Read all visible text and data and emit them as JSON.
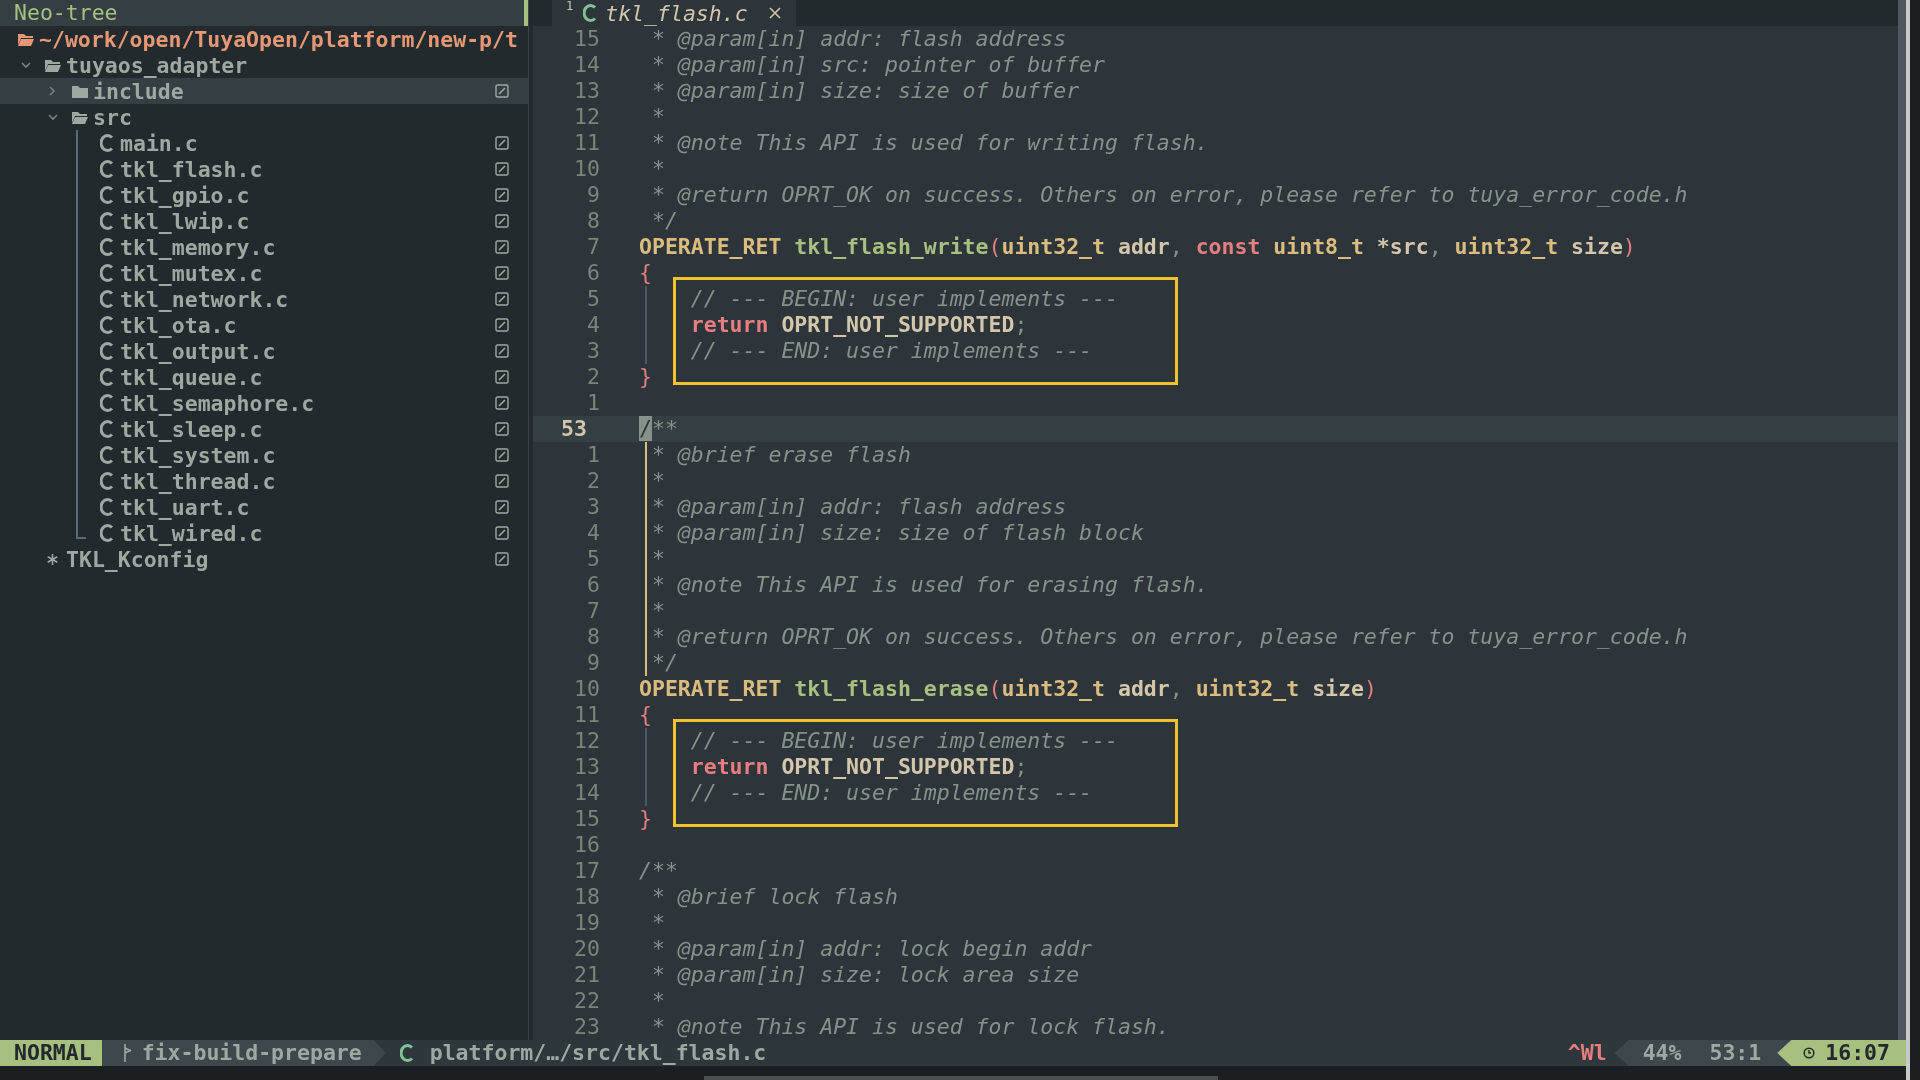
{
  "tree": {
    "title": "Neo-tree",
    "root": "~/work/open/TuyaOpen/platform/new-p/t",
    "items": [
      {
        "kind": "folder",
        "name": "tuyaos_adapter",
        "expanded": true,
        "selected": false,
        "children": [
          {
            "kind": "folder",
            "name": "include",
            "expanded": false,
            "selected": true,
            "modified": true
          },
          {
            "kind": "folder",
            "name": "src",
            "expanded": true,
            "selected": false,
            "children": [
              {
                "kind": "c",
                "name": "main.c",
                "selected": false,
                "modified": true
              },
              {
                "kind": "c",
                "name": "tkl_flash.c",
                "selected": false,
                "modified": true
              },
              {
                "kind": "c",
                "name": "tkl_gpio.c",
                "selected": false,
                "modified": true
              },
              {
                "kind": "c",
                "name": "tkl_lwip.c",
                "selected": false,
                "modified": true
              },
              {
                "kind": "c",
                "name": "tkl_memory.c",
                "selected": false,
                "modified": true
              },
              {
                "kind": "c",
                "name": "tkl_mutex.c",
                "selected": false,
                "modified": true
              },
              {
                "kind": "c",
                "name": "tkl_network.c",
                "selected": false,
                "modified": true
              },
              {
                "kind": "c",
                "name": "tkl_ota.c",
                "selected": false,
                "modified": true
              },
              {
                "kind": "c",
                "name": "tkl_output.c",
                "selected": false,
                "modified": true
              },
              {
                "kind": "c",
                "name": "tkl_queue.c",
                "selected": false,
                "modified": true
              },
              {
                "kind": "c",
                "name": "tkl_semaphore.c",
                "selected": false,
                "modified": true
              },
              {
                "kind": "c",
                "name": "tkl_sleep.c",
                "selected": false,
                "modified": true
              },
              {
                "kind": "c",
                "name": "tkl_system.c",
                "selected": false,
                "modified": true
              },
              {
                "kind": "c",
                "name": "tkl_thread.c",
                "selected": false,
                "modified": true
              },
              {
                "kind": "c",
                "name": "tkl_uart.c",
                "selected": false,
                "modified": true
              },
              {
                "kind": "c",
                "name": "tkl_wired.c",
                "selected": false,
                "modified": true
              }
            ]
          },
          {
            "kind": "config",
            "name": "TKL_Kconfig",
            "selected": false,
            "modified": true
          }
        ]
      }
    ]
  },
  "tab": {
    "index": "1",
    "label": "tkl_flash.c",
    "selected": true
  },
  "code": {
    "lines": [
      {
        "number": "15",
        "tokens": [
          {
            "kind": "comment",
            "text": " * @param[in] addr: flash address"
          }
        ]
      },
      {
        "number": "14",
        "tokens": [
          {
            "kind": "comment",
            "text": " * @param[in] src: pointer of buffer"
          }
        ]
      },
      {
        "number": "13",
        "tokens": [
          {
            "kind": "comment",
            "text": " * @param[in] size: size of buffer"
          }
        ]
      },
      {
        "number": "12",
        "tokens": [
          {
            "kind": "comment",
            "text": " *"
          }
        ]
      },
      {
        "number": "11",
        "tokens": [
          {
            "kind": "comment",
            "text": " * @note This API is used for writing flash."
          }
        ]
      },
      {
        "number": "10",
        "tokens": [
          {
            "kind": "comment",
            "text": " *"
          }
        ]
      },
      {
        "number": "9",
        "tokens": [
          {
            "kind": "comment",
            "text": " * @return OPRT_OK on success. Others on error, please refer to tuya_error_code.h"
          }
        ]
      },
      {
        "number": "8",
        "tokens": [
          {
            "kind": "comment",
            "text": " */"
          }
        ]
      },
      {
        "number": "7",
        "tokens": [
          {
            "kind": "type",
            "text": "OPERATE_RET"
          },
          {
            "kind": "func",
            "text": " tkl_flash_write"
          },
          {
            "kind": "paren",
            "text": "("
          },
          {
            "kind": "type",
            "text": "uint32_t"
          },
          {
            "kind": "text",
            "text": " addr"
          },
          {
            "kind": "punct",
            "text": ", "
          },
          {
            "kind": "keyword",
            "text": "const "
          },
          {
            "kind": "type",
            "text": "uint8_t"
          },
          {
            "kind": "text",
            "text": " *src"
          },
          {
            "kind": "punct",
            "text": ", "
          },
          {
            "kind": "type",
            "text": "uint32_t"
          },
          {
            "kind": "text",
            "text": " size"
          },
          {
            "kind": "paren",
            "text": ")"
          }
        ]
      },
      {
        "number": "6",
        "tokens": [
          {
            "kind": "paren",
            "text": "{"
          }
        ]
      },
      {
        "number": "5",
        "guide": true,
        "guide_active": false,
        "boxed": true,
        "tokens": [
          {
            "kind": "comment",
            "text": "    // --- BEGIN: user implements ---"
          }
        ]
      },
      {
        "number": "4",
        "guide": true,
        "guide_active": false,
        "boxed": true,
        "tokens": [
          {
            "kind": "keyword",
            "text": "    return"
          },
          {
            "kind": "text",
            "text": " OPRT_NOT_SUPPORTED"
          },
          {
            "kind": "punct",
            "text": ";"
          }
        ]
      },
      {
        "number": "3",
        "guide": true,
        "guide_active": false,
        "boxed": true,
        "tokens": [
          {
            "kind": "comment",
            "text": "    // --- END: user implements ---"
          }
        ]
      },
      {
        "number": "2",
        "tokens": [
          {
            "kind": "paren",
            "text": "}"
          }
        ]
      },
      {
        "number": "1"
      },
      {
        "number": "53",
        "current": true,
        "tokens": [
          {
            "kind": "cursor",
            "text": "/"
          },
          {
            "kind": "comment",
            "text": "**"
          }
        ]
      },
      {
        "number": "1",
        "guide": true,
        "guide_active": true,
        "tokens": [
          {
            "kind": "comment",
            "text": " * @brief erase flash"
          }
        ]
      },
      {
        "number": "2",
        "guide": true,
        "guide_active": true,
        "tokens": [
          {
            "kind": "comment",
            "text": " *"
          }
        ]
      },
      {
        "number": "3",
        "guide": true,
        "guide_active": true,
        "tokens": [
          {
            "kind": "comment",
            "text": " * @param[in] addr: flash address"
          }
        ]
      },
      {
        "number": "4",
        "guide": true,
        "guide_active": true,
        "tokens": [
          {
            "kind": "comment",
            "text": " * @param[in] size: size of flash block"
          }
        ]
      },
      {
        "number": "5",
        "guide": true,
        "guide_active": true,
        "tokens": [
          {
            "kind": "comment",
            "text": " *"
          }
        ]
      },
      {
        "number": "6",
        "guide": true,
        "guide_active": true,
        "tokens": [
          {
            "kind": "comment",
            "text": " * @note This API is used for erasing flash."
          }
        ]
      },
      {
        "number": "7",
        "guide": true,
        "guide_active": true,
        "tokens": [
          {
            "kind": "comment",
            "text": " *"
          }
        ]
      },
      {
        "number": "8",
        "guide": true,
        "guide_active": true,
        "tokens": [
          {
            "kind": "comment",
            "text": " * @return OPRT_OK on success. Others on error, please refer to tuya_error_code.h"
          }
        ]
      },
      {
        "number": "9",
        "guide": true,
        "guide_active": true,
        "tokens": [
          {
            "kind": "comment",
            "text": " */"
          }
        ]
      },
      {
        "number": "10",
        "tokens": [
          {
            "kind": "type",
            "text": "OPERATE_RET"
          },
          {
            "kind": "func",
            "text": " tkl_flash_erase"
          },
          {
            "kind": "paren",
            "text": "("
          },
          {
            "kind": "type",
            "text": "uint32_t"
          },
          {
            "kind": "text",
            "text": " addr"
          },
          {
            "kind": "punct",
            "text": ", "
          },
          {
            "kind": "type",
            "text": "uint32_t"
          },
          {
            "kind": "text",
            "text": " size"
          },
          {
            "kind": "paren",
            "text": ")"
          }
        ]
      },
      {
        "number": "11",
        "tokens": [
          {
            "kind": "paren",
            "text": "{"
          }
        ]
      },
      {
        "number": "12",
        "guide": true,
        "guide_active": false,
        "boxed": true,
        "tokens": [
          {
            "kind": "comment",
            "text": "    // --- BEGIN: user implements ---"
          }
        ]
      },
      {
        "number": "13",
        "guide": true,
        "guide_active": false,
        "boxed": true,
        "tokens": [
          {
            "kind": "keyword",
            "text": "    return"
          },
          {
            "kind": "text",
            "text": " OPRT_NOT_SUPPORTED"
          },
          {
            "kind": "punct",
            "text": ";"
          }
        ]
      },
      {
        "number": "14",
        "guide": true,
        "guide_active": false,
        "boxed": true,
        "tokens": [
          {
            "kind": "comment",
            "text": "    // --- END: user implements ---"
          }
        ]
      },
      {
        "number": "15",
        "tokens": [
          {
            "kind": "paren",
            "text": "}"
          }
        ]
      },
      {
        "number": "16"
      },
      {
        "number": "17",
        "tokens": [
          {
            "kind": "comment",
            "text": "/**"
          }
        ]
      },
      {
        "number": "18",
        "tokens": [
          {
            "kind": "comment",
            "text": " * @brief lock flash"
          }
        ]
      },
      {
        "number": "19",
        "tokens": [
          {
            "kind": "comment",
            "text": " *"
          }
        ]
      },
      {
        "number": "20",
        "tokens": [
          {
            "kind": "comment",
            "text": " * @param[in] addr: lock begin addr"
          }
        ]
      },
      {
        "number": "21",
        "tokens": [
          {
            "kind": "comment",
            "text": " * @param[in] size: lock area size"
          }
        ]
      },
      {
        "number": "22",
        "tokens": [
          {
            "kind": "comment",
            "text": " *"
          }
        ]
      },
      {
        "number": "23",
        "tokens": [
          {
            "kind": "comment",
            "text": " * @note This API is used for lock flash."
          }
        ]
      }
    ]
  },
  "status_bar": {
    "mode": "NORMAL",
    "branch": "fix-build-prepare",
    "file": "platform/…/src/tkl_flash.c",
    "keys": "^Wl",
    "percent": "44%",
    "position": "53:1",
    "time": "16:07"
  }
}
